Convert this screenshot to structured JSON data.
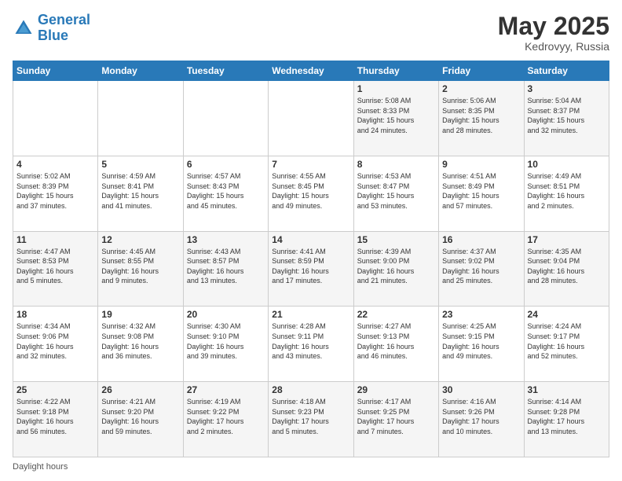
{
  "logo": {
    "line1": "General",
    "line2": "Blue"
  },
  "title": "May 2025",
  "subtitle": "Kedrovyy, Russia",
  "days_of_week": [
    "Sunday",
    "Monday",
    "Tuesday",
    "Wednesday",
    "Thursday",
    "Friday",
    "Saturday"
  ],
  "footer": "Daylight hours",
  "weeks": [
    [
      {
        "day": "",
        "info": ""
      },
      {
        "day": "",
        "info": ""
      },
      {
        "day": "",
        "info": ""
      },
      {
        "day": "",
        "info": ""
      },
      {
        "day": "1",
        "info": "Sunrise: 5:08 AM\nSunset: 8:33 PM\nDaylight: 15 hours\nand 24 minutes."
      },
      {
        "day": "2",
        "info": "Sunrise: 5:06 AM\nSunset: 8:35 PM\nDaylight: 15 hours\nand 28 minutes."
      },
      {
        "day": "3",
        "info": "Sunrise: 5:04 AM\nSunset: 8:37 PM\nDaylight: 15 hours\nand 32 minutes."
      }
    ],
    [
      {
        "day": "4",
        "info": "Sunrise: 5:02 AM\nSunset: 8:39 PM\nDaylight: 15 hours\nand 37 minutes."
      },
      {
        "day": "5",
        "info": "Sunrise: 4:59 AM\nSunset: 8:41 PM\nDaylight: 15 hours\nand 41 minutes."
      },
      {
        "day": "6",
        "info": "Sunrise: 4:57 AM\nSunset: 8:43 PM\nDaylight: 15 hours\nand 45 minutes."
      },
      {
        "day": "7",
        "info": "Sunrise: 4:55 AM\nSunset: 8:45 PM\nDaylight: 15 hours\nand 49 minutes."
      },
      {
        "day": "8",
        "info": "Sunrise: 4:53 AM\nSunset: 8:47 PM\nDaylight: 15 hours\nand 53 minutes."
      },
      {
        "day": "9",
        "info": "Sunrise: 4:51 AM\nSunset: 8:49 PM\nDaylight: 15 hours\nand 57 minutes."
      },
      {
        "day": "10",
        "info": "Sunrise: 4:49 AM\nSunset: 8:51 PM\nDaylight: 16 hours\nand 2 minutes."
      }
    ],
    [
      {
        "day": "11",
        "info": "Sunrise: 4:47 AM\nSunset: 8:53 PM\nDaylight: 16 hours\nand 5 minutes."
      },
      {
        "day": "12",
        "info": "Sunrise: 4:45 AM\nSunset: 8:55 PM\nDaylight: 16 hours\nand 9 minutes."
      },
      {
        "day": "13",
        "info": "Sunrise: 4:43 AM\nSunset: 8:57 PM\nDaylight: 16 hours\nand 13 minutes."
      },
      {
        "day": "14",
        "info": "Sunrise: 4:41 AM\nSunset: 8:59 PM\nDaylight: 16 hours\nand 17 minutes."
      },
      {
        "day": "15",
        "info": "Sunrise: 4:39 AM\nSunset: 9:00 PM\nDaylight: 16 hours\nand 21 minutes."
      },
      {
        "day": "16",
        "info": "Sunrise: 4:37 AM\nSunset: 9:02 PM\nDaylight: 16 hours\nand 25 minutes."
      },
      {
        "day": "17",
        "info": "Sunrise: 4:35 AM\nSunset: 9:04 PM\nDaylight: 16 hours\nand 28 minutes."
      }
    ],
    [
      {
        "day": "18",
        "info": "Sunrise: 4:34 AM\nSunset: 9:06 PM\nDaylight: 16 hours\nand 32 minutes."
      },
      {
        "day": "19",
        "info": "Sunrise: 4:32 AM\nSunset: 9:08 PM\nDaylight: 16 hours\nand 36 minutes."
      },
      {
        "day": "20",
        "info": "Sunrise: 4:30 AM\nSunset: 9:10 PM\nDaylight: 16 hours\nand 39 minutes."
      },
      {
        "day": "21",
        "info": "Sunrise: 4:28 AM\nSunset: 9:11 PM\nDaylight: 16 hours\nand 43 minutes."
      },
      {
        "day": "22",
        "info": "Sunrise: 4:27 AM\nSunset: 9:13 PM\nDaylight: 16 hours\nand 46 minutes."
      },
      {
        "day": "23",
        "info": "Sunrise: 4:25 AM\nSunset: 9:15 PM\nDaylight: 16 hours\nand 49 minutes."
      },
      {
        "day": "24",
        "info": "Sunrise: 4:24 AM\nSunset: 9:17 PM\nDaylight: 16 hours\nand 52 minutes."
      }
    ],
    [
      {
        "day": "25",
        "info": "Sunrise: 4:22 AM\nSunset: 9:18 PM\nDaylight: 16 hours\nand 56 minutes."
      },
      {
        "day": "26",
        "info": "Sunrise: 4:21 AM\nSunset: 9:20 PM\nDaylight: 16 hours\nand 59 minutes."
      },
      {
        "day": "27",
        "info": "Sunrise: 4:19 AM\nSunset: 9:22 PM\nDaylight: 17 hours\nand 2 minutes."
      },
      {
        "day": "28",
        "info": "Sunrise: 4:18 AM\nSunset: 9:23 PM\nDaylight: 17 hours\nand 5 minutes."
      },
      {
        "day": "29",
        "info": "Sunrise: 4:17 AM\nSunset: 9:25 PM\nDaylight: 17 hours\nand 7 minutes."
      },
      {
        "day": "30",
        "info": "Sunrise: 4:16 AM\nSunset: 9:26 PM\nDaylight: 17 hours\nand 10 minutes."
      },
      {
        "day": "31",
        "info": "Sunrise: 4:14 AM\nSunset: 9:28 PM\nDaylight: 17 hours\nand 13 minutes."
      }
    ]
  ]
}
